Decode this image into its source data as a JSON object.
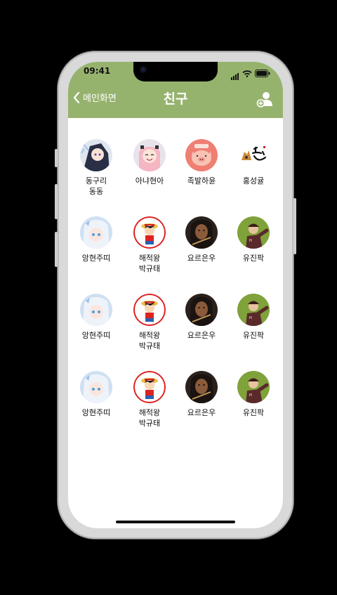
{
  "status_bar": {
    "time": "09:41"
  },
  "header": {
    "back_label": "메인화면",
    "title": "친구",
    "bg_color": "#96b36e"
  },
  "friends": [
    {
      "name": "동구리\n동동",
      "avatar": "anime-girl-avatar"
    },
    {
      "name": "아냐현아",
      "avatar": "anya-avatar"
    },
    {
      "name": "족발하윤",
      "avatar": "pig-avatar"
    },
    {
      "name": "홍성귤",
      "avatar": "deer-calligraphy-avatar"
    },
    {
      "name": "앙현주띠",
      "avatar": "white-hair-anime-avatar"
    },
    {
      "name": "해적왕\n박규태",
      "avatar": "pirate-luffy-avatar"
    },
    {
      "name": "요르은우",
      "avatar": "dark-hair-portrait-avatar"
    },
    {
      "name": "유진팍",
      "avatar": "baseball-player-avatar"
    },
    {
      "name": "앙현주띠",
      "avatar": "white-hair-anime-avatar"
    },
    {
      "name": "해적왕\n박규태",
      "avatar": "pirate-luffy-avatar"
    },
    {
      "name": "요르은우",
      "avatar": "dark-hair-portrait-avatar"
    },
    {
      "name": "유진팍",
      "avatar": "baseball-player-avatar"
    },
    {
      "name": "앙현주띠",
      "avatar": "white-hair-anime-avatar"
    },
    {
      "name": "해적왕\n박규태",
      "avatar": "pirate-luffy-avatar"
    },
    {
      "name": "요르은우",
      "avatar": "dark-hair-portrait-avatar"
    },
    {
      "name": "유진팍",
      "avatar": "baseball-player-avatar"
    }
  ]
}
